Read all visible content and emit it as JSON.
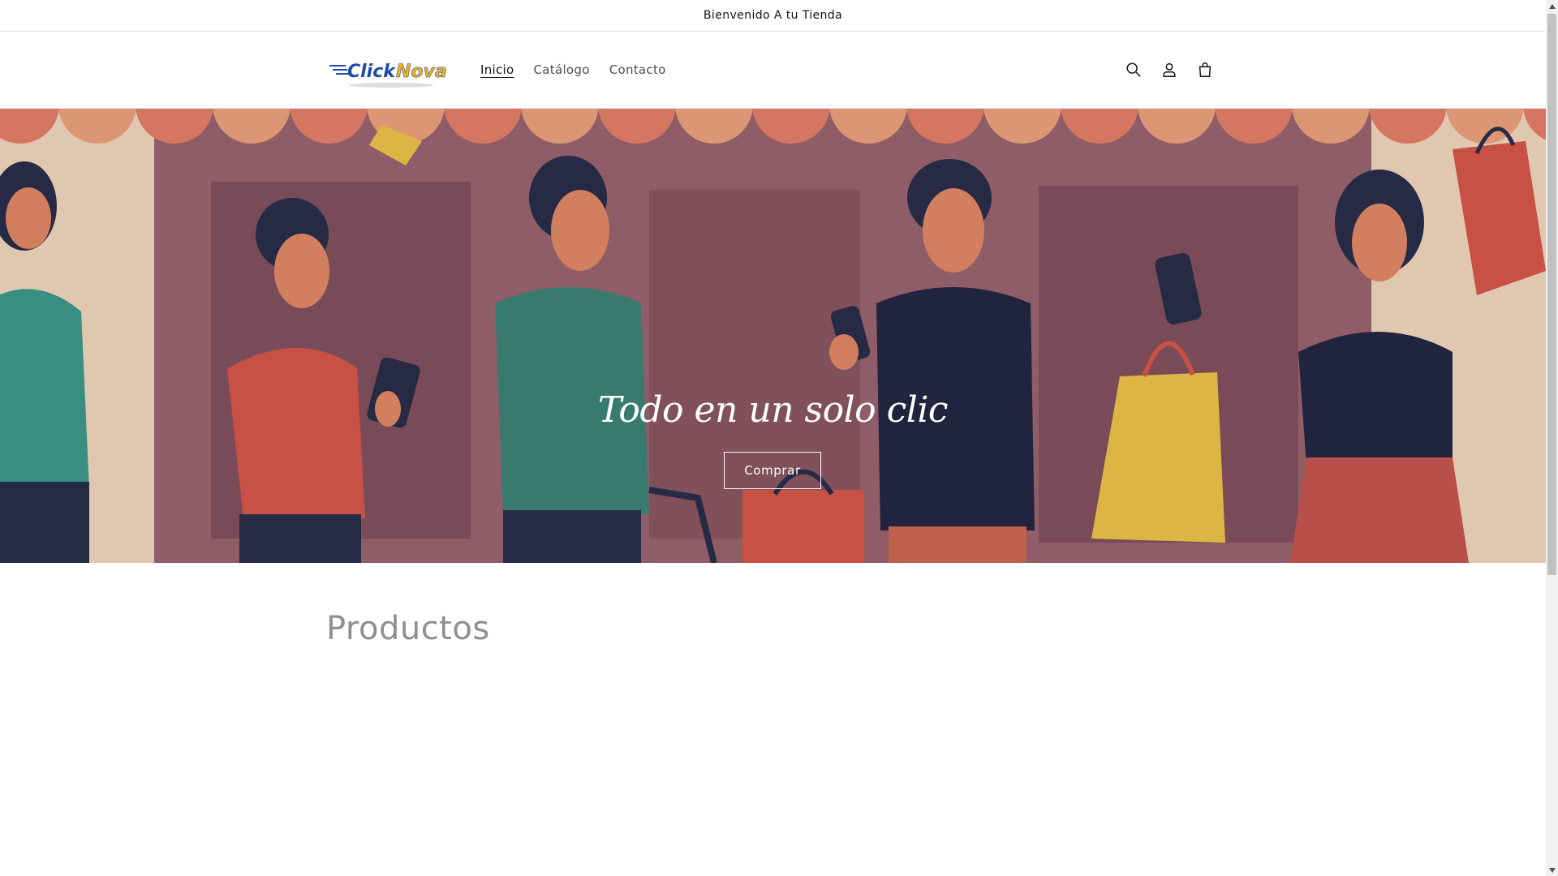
{
  "announcement": {
    "text": "Bienvenido A tu Tienda"
  },
  "header": {
    "logo": {
      "text_main": "Click",
      "text_accent": "Nova"
    },
    "nav": [
      {
        "label": "Inicio",
        "active": true
      },
      {
        "label": "Catálogo",
        "active": false
      },
      {
        "label": "Contacto",
        "active": false
      }
    ],
    "icons": [
      "search-icon",
      "account-icon",
      "cart-icon"
    ]
  },
  "hero": {
    "title": "Todo en un solo clic",
    "button_label": "Comprar"
  },
  "products": {
    "heading": "Productos"
  },
  "colors": {
    "hero_background": "#9c6570",
    "awning_a": "#e8806a",
    "awning_b": "#f0a37e",
    "text": "#121212",
    "muted_heading": "#8f8f8f",
    "logo_blue": "#1f4aa8",
    "logo_yellow": "#f2b41e"
  }
}
